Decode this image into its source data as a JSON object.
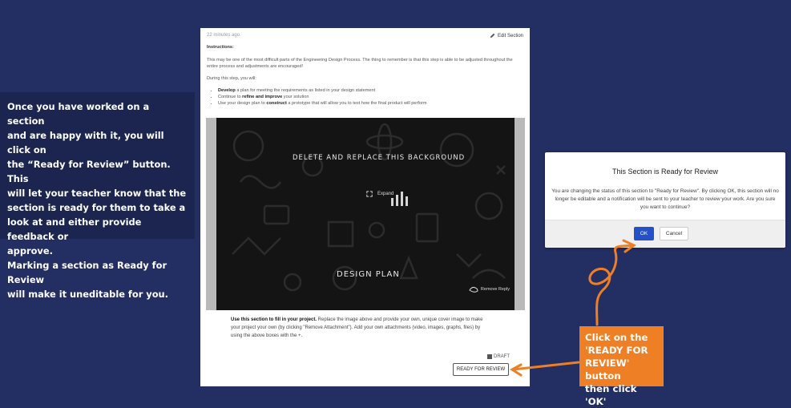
{
  "left_callout": {
    "lines": [
      "Once you have worked on a section",
      "and are happy with it, you will click on",
      "the “Ready for Review” button. This",
      "will let your teacher know that the",
      "section is ready for them to take a",
      "look at and either provide feedback or",
      "approve.",
      "Marking a section as Ready for Review",
      "will make it uneditable for you."
    ]
  },
  "document": {
    "timestamp": "22 minutes ago",
    "edit_label": "Edit Section",
    "instructions_heading": "Instructions:",
    "intro": "This may be one of the most difficult parts of the Engineering Design Process. The thing to remember is that this step is able to be adjusted throughout the entire process and adjustments are encouraged!",
    "during_step": "During this step, you will:",
    "bullets": [
      {
        "bold": "Develop",
        "rest": " a plan for meeting the requirements as listed in your design statement"
      },
      {
        "pre": "Continue to ",
        "bold": "refine and improve",
        "rest": " your solution"
      },
      {
        "pre": "Use your design plan to ",
        "bold": "construct",
        "rest": " a prototype that will allow you to test how the final product will perform"
      }
    ],
    "image_text_top": "DELETE AND REPLACE THIS BACKGROUND",
    "image_text_bottom": "DESIGN PLAN",
    "expand_label": "Expand",
    "remove_label": "Remove Reply",
    "footer_bold": "Use this section to fill in your project.",
    "footer_rest": " Replace the image above and provide your own, unique cover image to make your project your own (by clicking \"Remove Attachment\"). Add your own attachments (video, images, graphs, files) by using the above boxes with the +.",
    "draft_label": "DRAFT",
    "review_button": "READY FOR REVIEW"
  },
  "modal": {
    "title": "This Section is Ready for Review",
    "message": "You are changing the status of this section to \"Ready for Review\". By clicking OK, this section will no longer be editable and a notification will be sent to your teacher to review your work. Are you sure you want to continue?",
    "ok_label": "OK",
    "cancel_label": "Cancel"
  },
  "orange_callout": {
    "lines": [
      "Click on the",
      "'READY FOR",
      "REVIEW' button",
      "then click 'OK'"
    ]
  },
  "colors": {
    "background": "#232e63",
    "callout_dark": "#1b254f",
    "accent_orange": "#ee7f24",
    "ok_blue": "#2451c8"
  }
}
